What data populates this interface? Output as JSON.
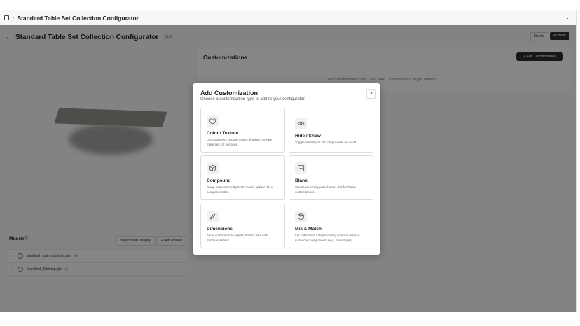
{
  "topbar": {
    "title": "Standard Table Set Collection Configurator",
    "chevron": "›",
    "more": "···"
  },
  "header": {
    "back": "←",
    "title": "Standard Table Set Collection Configurator",
    "draft": "Draft",
    "delete_label": "Delete",
    "activate_label": "Activate"
  },
  "models": {
    "title": "Models",
    "count": "2",
    "import_label": "Import from Shopify",
    "add_label": "+ Add Models",
    "items": [
      {
        "caret": "›",
        "name": "standard_main-materials.glb",
        "badge": "6"
      },
      {
        "caret": "›",
        "name": "Standard_Tabletop.glb",
        "badge": "4"
      }
    ]
  },
  "customizations": {
    "title": "Customizations",
    "add_label": "+ Add Customization",
    "empty": "No customizations yet. Click \"Add Customization\" to get started."
  },
  "modal": {
    "title": "Add Customization",
    "subtitle": "Choose a customization type to add to your configurator.",
    "close": "✕",
    "cards": [
      {
        "title": "Color / Texture",
        "desc": "Let customers choose colors, finishes, or PBR materials for surfaces.",
        "icon": "palette-icon"
      },
      {
        "title": "Hide / Show",
        "desc": "Toggle visibility of 3D components on or off.",
        "icon": "eye-icon"
      },
      {
        "title": "Compound",
        "desc": "Swap between multiple 3D model options for a component slot.",
        "icon": "cube-icon"
      },
      {
        "title": "Blank",
        "desc": "Create an empty placeholder slot for future customization.",
        "icon": "plus-square-icon"
      },
      {
        "title": "Dimensions",
        "desc": "Allow customers to adjust product size with min/max sliders.",
        "icon": "ruler-icon"
      },
      {
        "title": "Mix & Match",
        "desc": "Let customers independently swap or replace instanced components (e.g. chair styles).",
        "icon": "package-icon"
      }
    ]
  }
}
